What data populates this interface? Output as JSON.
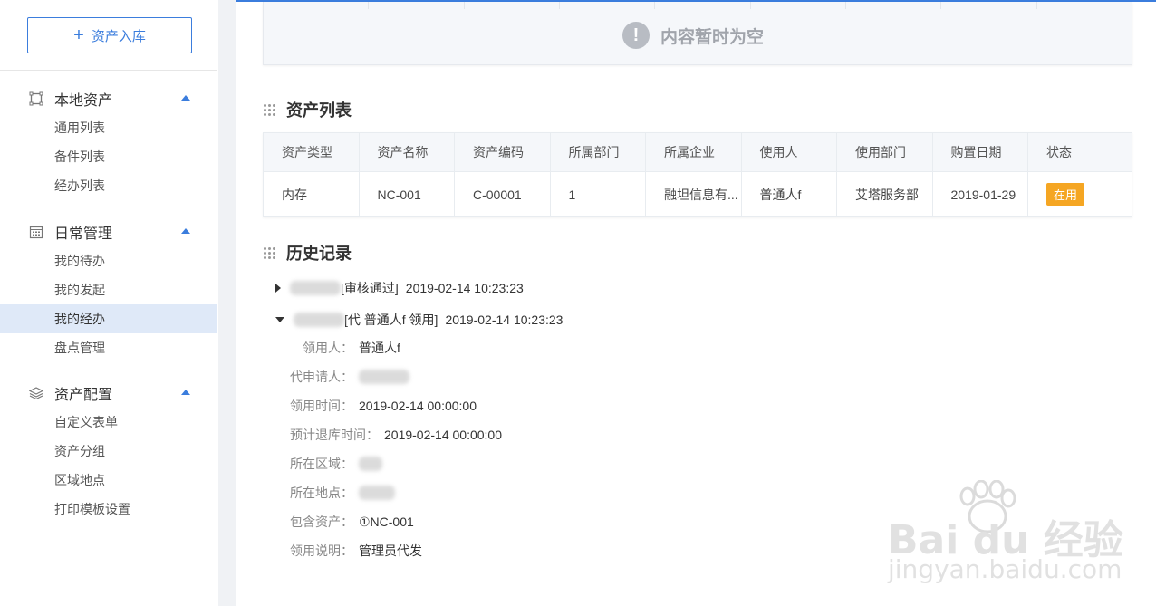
{
  "sidebar": {
    "add_button": "资产入库",
    "groups": [
      {
        "title": "本地资产",
        "icon": "frame-icon",
        "items": [
          "通用列表",
          "备件列表",
          "经办列表"
        ]
      },
      {
        "title": "日常管理",
        "icon": "calendar-icon",
        "items": [
          "我的待办",
          "我的发起",
          "我的经办",
          "盘点管理"
        ]
      },
      {
        "title": "资产配置",
        "icon": "layers-icon",
        "items": [
          "自定义表单",
          "资产分组",
          "区域地点",
          "打印模板设置"
        ]
      }
    ],
    "active_item": "我的经办"
  },
  "empty_state": {
    "message": "内容暂时为空",
    "icon": "exclamation-icon"
  },
  "asset_list": {
    "title": "资产列表",
    "columns": [
      "资产类型",
      "资产名称",
      "资产编码",
      "所属部门",
      "所属企业",
      "使用人",
      "使用部门",
      "购置日期",
      "状态"
    ],
    "rows": [
      [
        "内存",
        "NC-001",
        "C-00001",
        "1",
        "融坦信息有...",
        "普通人f",
        "艾塔服务部",
        "2019-01-29",
        "在用"
      ]
    ],
    "status_color": "#f5a623"
  },
  "history": {
    "title": "历史记录",
    "entries": [
      {
        "action": "[审核通过]",
        "time": "2019-02-14 10:23:23",
        "expanded": false
      },
      {
        "action": "[代 普通人f 领用]",
        "time": "2019-02-14 10:23:23",
        "expanded": true
      }
    ],
    "details": [
      {
        "label": "领用人：",
        "value": "普通人f"
      },
      {
        "label": "代申请人：",
        "value": ""
      },
      {
        "label": "领用时间：",
        "value": "2019-02-14 00:00:00"
      },
      {
        "label": "预计退库时间：",
        "value": "2019-02-14 00:00:00"
      },
      {
        "label": "所在区域：",
        "value": ""
      },
      {
        "label": "所在地点：",
        "value": ""
      },
      {
        "label": "包含资产：",
        "value": "①NC-001"
      },
      {
        "label": "领用说明：",
        "value": "管理员代发"
      }
    ]
  },
  "watermark": {
    "logo": "Bai du 经验",
    "url": "jingyan.baidu.com"
  },
  "accent_color": "#3b7ddd"
}
